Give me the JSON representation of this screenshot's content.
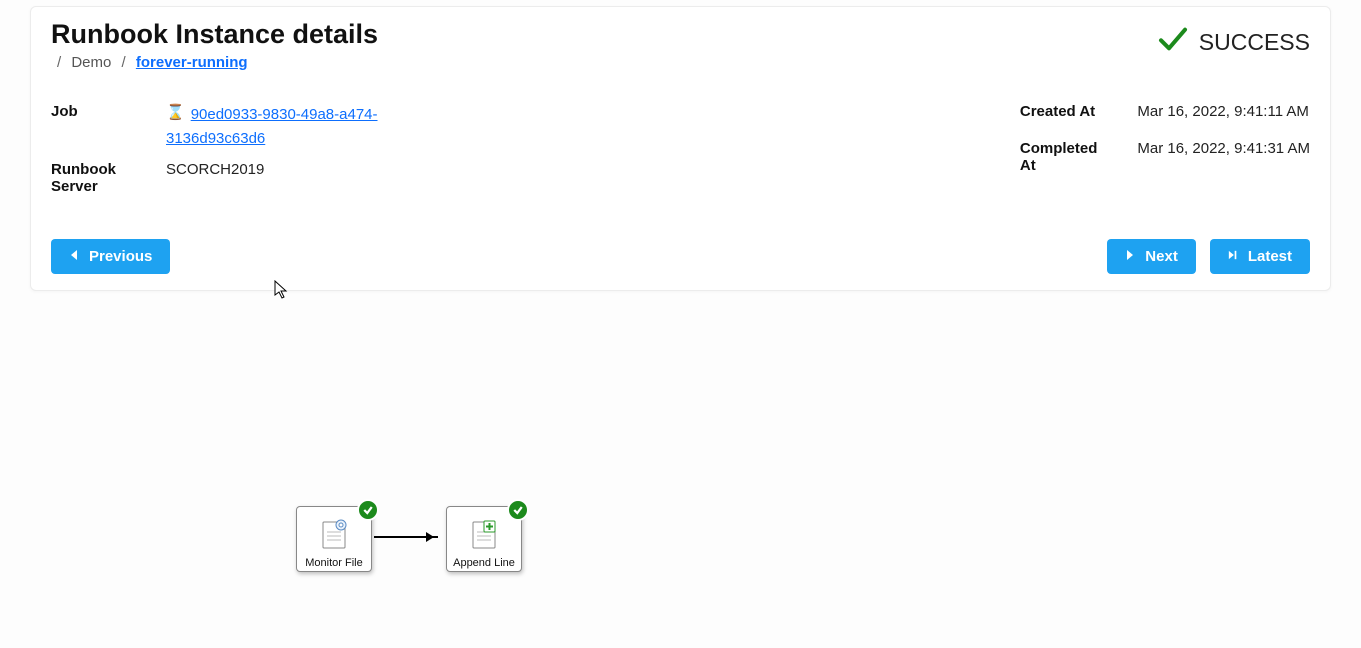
{
  "page": {
    "title": "Runbook Instance details"
  },
  "breadcrumbs": {
    "folder": "Demo",
    "runbook": "forever-running"
  },
  "status": {
    "label": "SUCCESS"
  },
  "details": {
    "job_label": "Job",
    "job_id": "90ed0933-9830-49a8-a474-3136d93c63d6",
    "server_label": "Runbook Server",
    "server": "SCORCH2019",
    "created_label": "Created At",
    "created_value": "Mar 16, 2022, 9:41:11 AM",
    "completed_label": "Completed At",
    "completed_value": "Mar 16, 2022, 9:41:31 AM"
  },
  "buttons": {
    "previous": "Previous",
    "next": "Next",
    "latest": "Latest"
  },
  "activities": {
    "monitor": "Monitor File",
    "append": "Append Line"
  }
}
